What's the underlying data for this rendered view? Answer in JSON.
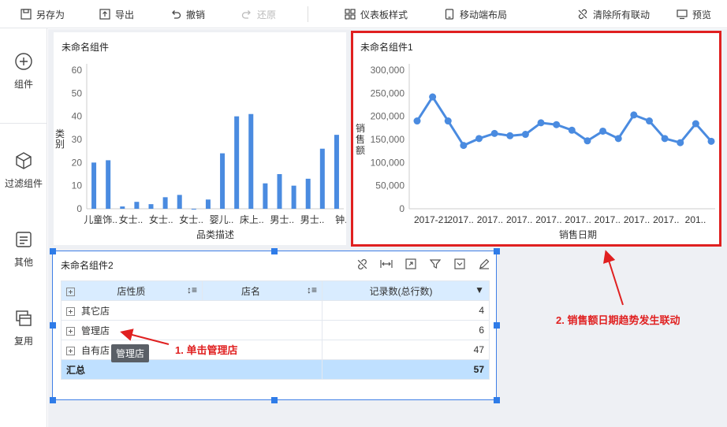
{
  "toolbar": {
    "save_as": "另存为",
    "export": "导出",
    "undo": "撤销",
    "redo": "还原",
    "dashboard_style": "仪表板样式",
    "mobile_layout": "移动端布局",
    "clear_linkage": "清除所有联动",
    "preview": "预览"
  },
  "sidebar": {
    "components": "组件",
    "filter_components": "过滤组件",
    "other": "其他",
    "reuse": "复用"
  },
  "widget1": {
    "title": "未命名组件",
    "chart_data": {
      "type": "bar",
      "categories": [
        "儿童饰..",
        "",
        "女士..",
        "",
        "女士..",
        "",
        "女士..",
        "",
        "婴儿..",
        "",
        "床上..",
        "",
        "男士..",
        "",
        "男士..",
        "",
        "钟.."
      ],
      "values": [
        20,
        21,
        1,
        3,
        2,
        5,
        6,
        0,
        4,
        24,
        40,
        41,
        11,
        15,
        10,
        13,
        26,
        32
      ],
      "xlabel": "品类描述",
      "ylabel": "类别",
      "yticks": [
        0,
        10,
        20,
        30,
        40,
        50,
        60
      ],
      "ylim": [
        0,
        60
      ],
      "color": "#4a8be0"
    }
  },
  "widget2": {
    "title": "未命名组件1",
    "chart_data": {
      "type": "line",
      "x_labels": [
        "2017-21",
        "2017..",
        "2017..",
        "2017..",
        "2017..",
        "2017..",
        "2017..",
        "2017..",
        "2017..",
        "201.."
      ],
      "values": [
        190000,
        242000,
        190000,
        137000,
        152000,
        163000,
        158000,
        161000,
        186000,
        182000,
        170000,
        147000,
        168000,
        152000,
        203000,
        190000,
        152000,
        143000,
        184000,
        146000
      ],
      "xlabel": "销售日期",
      "ylabel": "销售额",
      "yticks": [
        "0",
        "50,000",
        "100,000",
        "150,000",
        "200,000",
        "250,000",
        "300,000"
      ],
      "ylim": [
        0,
        300000
      ],
      "color": "#4a8be0"
    }
  },
  "widget3": {
    "title": "未命名组件2",
    "columns": [
      "店性质",
      "店名",
      "记录数(总行数)"
    ],
    "rows": [
      {
        "type": "其它店",
        "count": "4"
      },
      {
        "type": "管理店",
        "count": "6"
      },
      {
        "type": "自有店",
        "count": "47"
      }
    ],
    "total_label": "汇总",
    "total_value": "57",
    "tooltip": "管理店"
  },
  "annotations": {
    "a1": "1. 单击管理店",
    "a2": "2. 销售额日期趋势发生联动"
  }
}
